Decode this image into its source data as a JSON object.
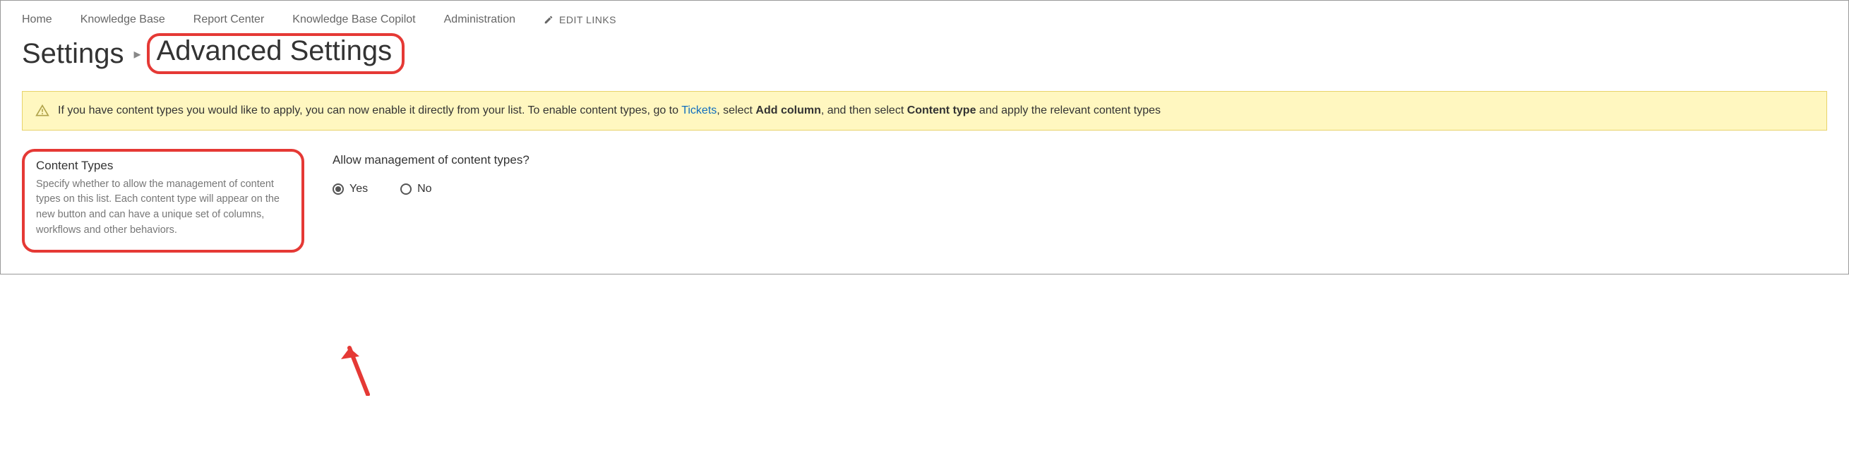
{
  "nav": {
    "items": [
      "Home",
      "Knowledge Base",
      "Report Center",
      "Knowledge Base Copilot",
      "Administration"
    ],
    "edit_links": "EDIT LINKS"
  },
  "breadcrumb": {
    "root": "Settings",
    "current": "Advanced Settings"
  },
  "notice": {
    "pre": "If you have content types you would like to apply, you can now enable it directly from your list. To enable content types, go to ",
    "link": "Tickets",
    "mid1": ", select ",
    "bold1": "Add column",
    "mid2": ", and then select ",
    "bold2": "Content type",
    "tail": " and apply the relevant content types"
  },
  "section": {
    "title": "Content Types",
    "desc": "Specify whether to allow the management of content types on this list. Each content type will appear on the new button and can have a unique set of columns, workflows and other behaviors."
  },
  "question": {
    "label": "Allow management of content types?",
    "yes": "Yes",
    "no": "No",
    "selected": "yes"
  },
  "colors": {
    "highlight": "#e53935",
    "notice_bg": "#fff7c0",
    "notice_border": "#e8d36a",
    "link": "#106ebe"
  }
}
